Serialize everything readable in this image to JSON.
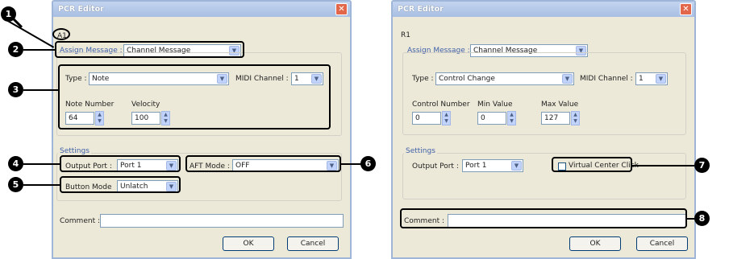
{
  "left_window": {
    "title": "PCR Editor",
    "control_id": "A1",
    "assign_label": "Assign Message :",
    "assign_value": "Channel Message",
    "type_label": "Type :",
    "type_value": "Note",
    "midi_label": "MIDI Channel :",
    "midi_value": "1",
    "param1_label": "Note Number",
    "param1_value": "64",
    "param2_label": "Velocity",
    "param2_value": "100",
    "settings_label": "Settings",
    "output_label": "Output Port :",
    "output_value": "Port 1",
    "aft_label": "AFT Mode :",
    "aft_value": "OFF",
    "button_mode_label": "Button Mode",
    "button_mode_value": "Unlatch",
    "comment_label": "Comment :",
    "ok": "OK",
    "cancel": "Cancel"
  },
  "right_window": {
    "title": "PCR Editor",
    "control_id": "R1",
    "assign_label": "Assign Message :",
    "assign_value": "Channel Message",
    "type_label": "Type :",
    "type_value": "Control Change",
    "midi_label": "MIDI Channel :",
    "midi_value": "1",
    "param1_label": "Control Number",
    "param1_value": "0",
    "param2_label": "Min Value",
    "param2_value": "0",
    "param3_label": "Max Value",
    "param3_value": "127",
    "settings_label": "Settings",
    "output_label": "Output Port :",
    "output_value": "Port 1",
    "vcc_label": "Virtual Center Click",
    "comment_label": "Comment :",
    "ok": "OK",
    "cancel": "Cancel"
  },
  "callouts": [
    "1",
    "2",
    "3",
    "4",
    "5",
    "6",
    "7",
    "8"
  ],
  "icons": {
    "close": "close-icon",
    "dropdown": "chevron-down-icon",
    "spin": "spinner-arrows-icon"
  },
  "colors": {
    "title_bar": "#a9bfe3",
    "group_label": "#3d5ea8",
    "close_button": "#e2674a"
  }
}
